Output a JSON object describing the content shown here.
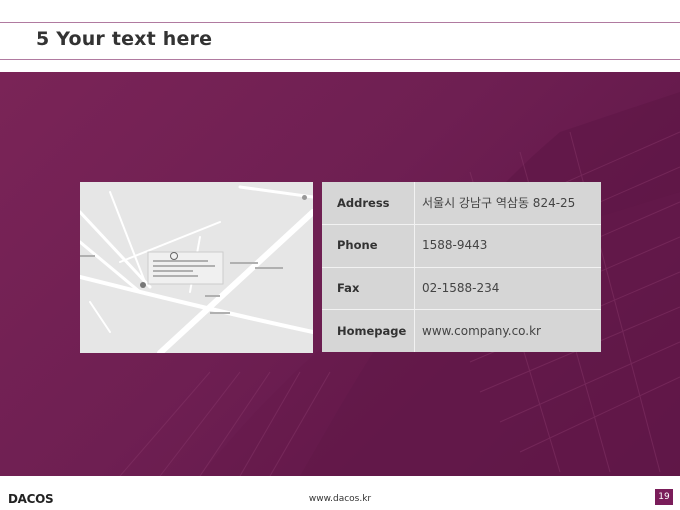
{
  "slide": {
    "title": "5 Your text here"
  },
  "contact": {
    "rows": [
      {
        "label": "Address",
        "value": "서울시 강남구 역삼동 824-25"
      },
      {
        "label": "Phone",
        "value": "1588-9443"
      },
      {
        "label": "Fax",
        "value": "02-1588-234"
      },
      {
        "label": "Homepage",
        "value": "www.company.co.kr"
      }
    ]
  },
  "footer": {
    "logo": "DACOS",
    "url": "www.dacos.kr",
    "page": "19"
  },
  "colors": {
    "accent": "#7a1d5a",
    "band": "#6e1f52"
  },
  "icons": [
    "map-pin-icon",
    "copyright-icon"
  ]
}
